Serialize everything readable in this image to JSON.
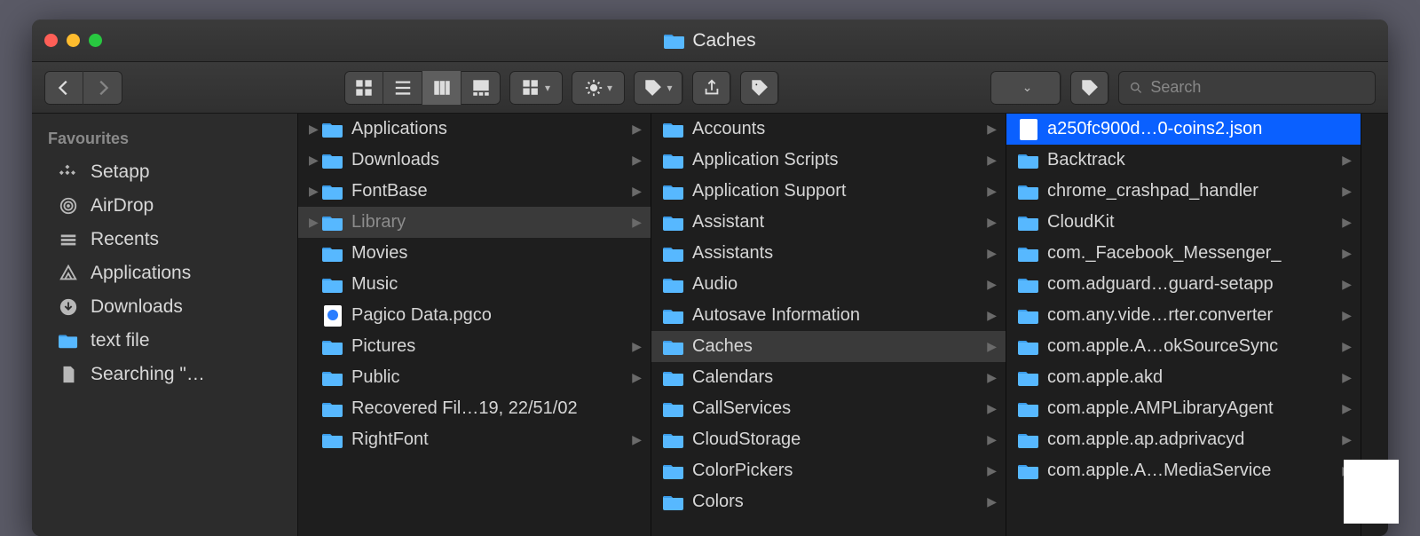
{
  "window": {
    "title": "Caches"
  },
  "toolbar": {
    "search_placeholder": "Search"
  },
  "sidebar": {
    "section": "Favourites",
    "items": [
      {
        "label": "Setapp"
      },
      {
        "label": "AirDrop"
      },
      {
        "label": "Recents"
      },
      {
        "label": "Applications"
      },
      {
        "label": "Downloads"
      },
      {
        "label": "text file"
      },
      {
        "label": "Searching \"…"
      }
    ]
  },
  "col1": [
    {
      "label": "Applications",
      "type": "folder",
      "arrow": true,
      "leftchev": true
    },
    {
      "label": "Downloads",
      "type": "folder",
      "arrow": true,
      "leftchev": true
    },
    {
      "label": "FontBase",
      "type": "folder",
      "arrow": true,
      "leftchev": true
    },
    {
      "label": "Library",
      "type": "folder",
      "arrow": true,
      "leftchev": true,
      "selpath": true,
      "dim": true
    },
    {
      "label": "Movies",
      "type": "folder",
      "arrow": false
    },
    {
      "label": "Music",
      "type": "folder",
      "arrow": false
    },
    {
      "label": "Pagico Data.pgco",
      "type": "doc",
      "arrow": false
    },
    {
      "label": "Pictures",
      "type": "folder",
      "arrow": true
    },
    {
      "label": "Public",
      "type": "folder",
      "arrow": true
    },
    {
      "label": "Recovered Fil…19, 22/51/02",
      "type": "folder",
      "arrow": false
    },
    {
      "label": "RightFont",
      "type": "folder",
      "arrow": true
    }
  ],
  "col2": [
    {
      "label": "Accounts",
      "arrow": true
    },
    {
      "label": "Application Scripts",
      "arrow": true
    },
    {
      "label": "Application Support",
      "arrow": true
    },
    {
      "label": "Assistant",
      "arrow": true
    },
    {
      "label": "Assistants",
      "arrow": true
    },
    {
      "label": "Audio",
      "arrow": true
    },
    {
      "label": "Autosave Information",
      "arrow": true
    },
    {
      "label": "Caches",
      "arrow": true,
      "selpath": true
    },
    {
      "label": "Calendars",
      "arrow": true
    },
    {
      "label": "CallServices",
      "arrow": true
    },
    {
      "label": "CloudStorage",
      "arrow": true
    },
    {
      "label": "ColorPickers",
      "arrow": true
    },
    {
      "label": "Colors",
      "arrow": true
    }
  ],
  "col3": [
    {
      "label": "a250fc900d…0-coins2.json",
      "type": "json",
      "arrow": false,
      "selactive": true
    },
    {
      "label": "Backtrack",
      "arrow": true
    },
    {
      "label": "chrome_crashpad_handler",
      "arrow": true
    },
    {
      "label": "CloudKit",
      "arrow": true
    },
    {
      "label": "com._Facebook_Messenger_",
      "arrow": true
    },
    {
      "label": "com.adguard…guard-setapp",
      "arrow": true
    },
    {
      "label": "com.any.vide…rter.converter",
      "arrow": true
    },
    {
      "label": "com.apple.A…okSourceSync",
      "arrow": true
    },
    {
      "label": "com.apple.akd",
      "arrow": true
    },
    {
      "label": "com.apple.AMPLibraryAgent",
      "arrow": true
    },
    {
      "label": "com.apple.ap.adprivacyd",
      "arrow": true
    },
    {
      "label": "com.apple.A…MediaService",
      "arrow": true
    }
  ]
}
